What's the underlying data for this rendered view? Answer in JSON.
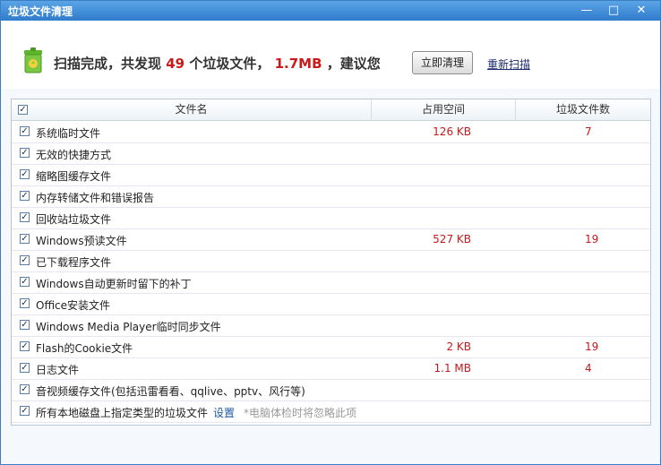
{
  "window": {
    "title": "垃圾文件清理",
    "minimize": "—",
    "maximize": "□",
    "close": "✕"
  },
  "status": {
    "prefix": "扫描完成，共发现",
    "count": "49",
    "mid": "个垃圾文件，",
    "size": "1.7MB",
    "suffix": "，建议您"
  },
  "actions": {
    "clean_label": "立即清理",
    "rescan_label": "重新扫描"
  },
  "table": {
    "headers": {
      "name": "文件名",
      "size": "占用空间",
      "count": "垃圾文件数"
    },
    "rows": [
      {
        "name": "系统临时文件",
        "size": "126 KB",
        "count": "7"
      },
      {
        "name": "无效的快捷方式",
        "size": "",
        "count": ""
      },
      {
        "name": "缩略图缓存文件",
        "size": "",
        "count": ""
      },
      {
        "name": "内存转储文件和错误报告",
        "size": "",
        "count": ""
      },
      {
        "name": "回收站垃圾文件",
        "size": "",
        "count": ""
      },
      {
        "name": "Windows预读文件",
        "size": "527 KB",
        "count": "19"
      },
      {
        "name": "已下载程序文件",
        "size": "",
        "count": ""
      },
      {
        "name": "Windows自动更新时留下的补丁",
        "size": "",
        "count": ""
      },
      {
        "name": "Office安装文件",
        "size": "",
        "count": ""
      },
      {
        "name": "Windows Media Player临时同步文件",
        "size": "",
        "count": ""
      },
      {
        "name": "Flash的Cookie文件",
        "size": "2 KB",
        "count": "19"
      },
      {
        "name": "日志文件",
        "size": "1.1 MB",
        "count": "4"
      },
      {
        "name": "音视频缓存文件(包括迅雷看看、qqlive、pptv、风行等)",
        "size": "",
        "count": ""
      },
      {
        "name": "所有本地磁盘上指定类型的垃圾文件",
        "size": "",
        "count": "",
        "setting": "设置",
        "hint": "*电脑体检时将忽略此项"
      }
    ]
  },
  "colors": {
    "accent": "#2f7ccc",
    "highlight": "#cc1a1a"
  }
}
